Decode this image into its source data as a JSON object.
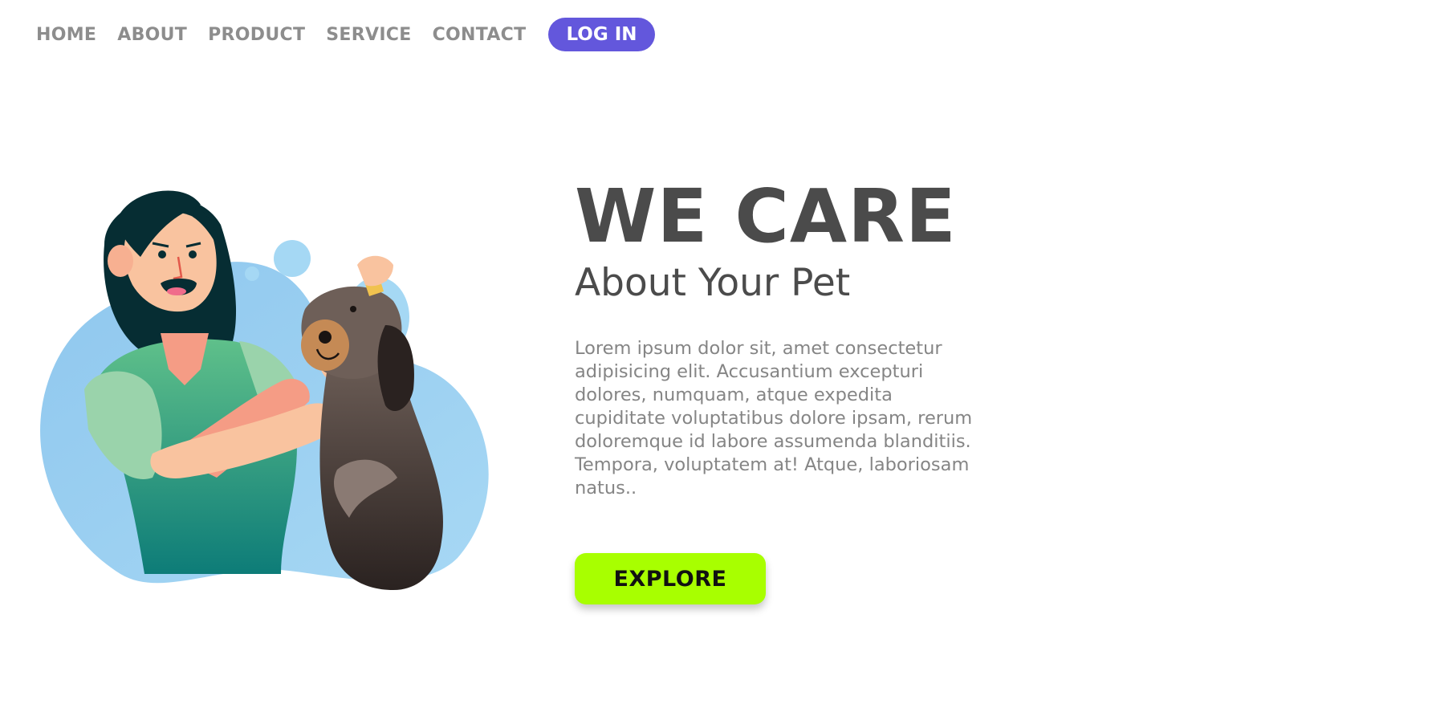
{
  "nav": {
    "links": [
      "HOME",
      "ABOUT",
      "PRODUCT",
      "SERVICE",
      "CONTACT"
    ],
    "login_label": "LOG IN"
  },
  "hero": {
    "title": "WE CARE",
    "subtitle": "About Your Pet",
    "body": "Lorem ipsum dolor sit, amet consectetur adipisicing elit. Accusantium excepturi dolores, numquam, atque expedita cupiditate voluptatibus dolore ipsam, rerum doloremque id labore assumenda blanditiis. Tempora, voluptatem at! Atque, laboriosam natus..",
    "explore_label": "EXPLORE",
    "illustration": "woman-giving-dog-ear-drops-illustration"
  },
  "colors": {
    "nav_text": "#8d8d8d",
    "login_bg": "#6357dc",
    "heading": "#4b4b4b",
    "body_text": "#858585",
    "explore_bg": "#a8ff00",
    "blob": "#8ec4ec"
  }
}
